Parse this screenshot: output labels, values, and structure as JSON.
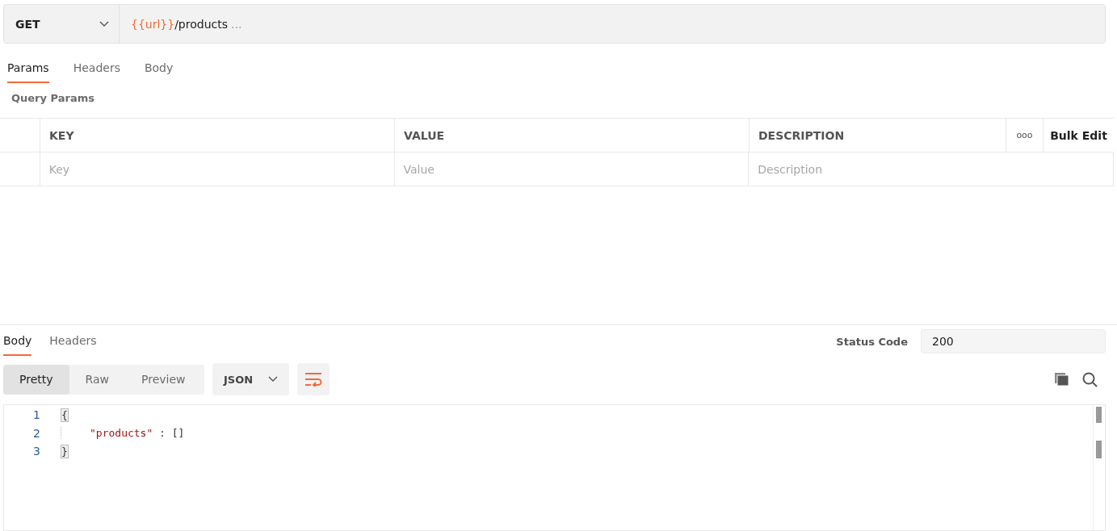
{
  "request": {
    "method": "GET",
    "url_parts": [
      {
        "kind": "variable",
        "text": "{{url}}"
      },
      {
        "kind": "text",
        "text": "/products"
      },
      {
        "kind": "ellipsis",
        "text": "..."
      }
    ]
  },
  "request_tabs": [
    {
      "label": "Params",
      "selected": true
    },
    {
      "label": "Headers",
      "selected": false
    },
    {
      "label": "Body",
      "selected": false
    }
  ],
  "section_title": "Query Params",
  "params_table": {
    "columns": [
      "KEY",
      "VALUE",
      "DESCRIPTION"
    ],
    "more": "ooo",
    "bulk_edit": "Bulk Edit",
    "placeholders": [
      "Key",
      "Value",
      "Description"
    ]
  },
  "response_tabs": [
    {
      "label": "Body",
      "selected": true
    },
    {
      "label": "Headers",
      "selected": false
    }
  ],
  "status": {
    "label": "Status Code",
    "value": "200"
  },
  "view_modes": [
    {
      "label": "Pretty",
      "selected": true
    },
    {
      "label": "Raw",
      "selected": false
    },
    {
      "label": "Preview",
      "selected": false
    }
  ],
  "format": "JSON",
  "code": [
    {
      "number": "1",
      "indented": false,
      "tokens": [
        {
          "kind": "bracket-match",
          "text": "{"
        }
      ]
    },
    {
      "number": "2",
      "indented": true,
      "tokens": [
        {
          "kind": "string",
          "text": "\"products\""
        },
        {
          "kind": "punct",
          "text": " : []"
        }
      ]
    },
    {
      "number": "3",
      "indented": false,
      "tokens": [
        {
          "kind": "bracket-match",
          "text": "}"
        }
      ]
    }
  ]
}
